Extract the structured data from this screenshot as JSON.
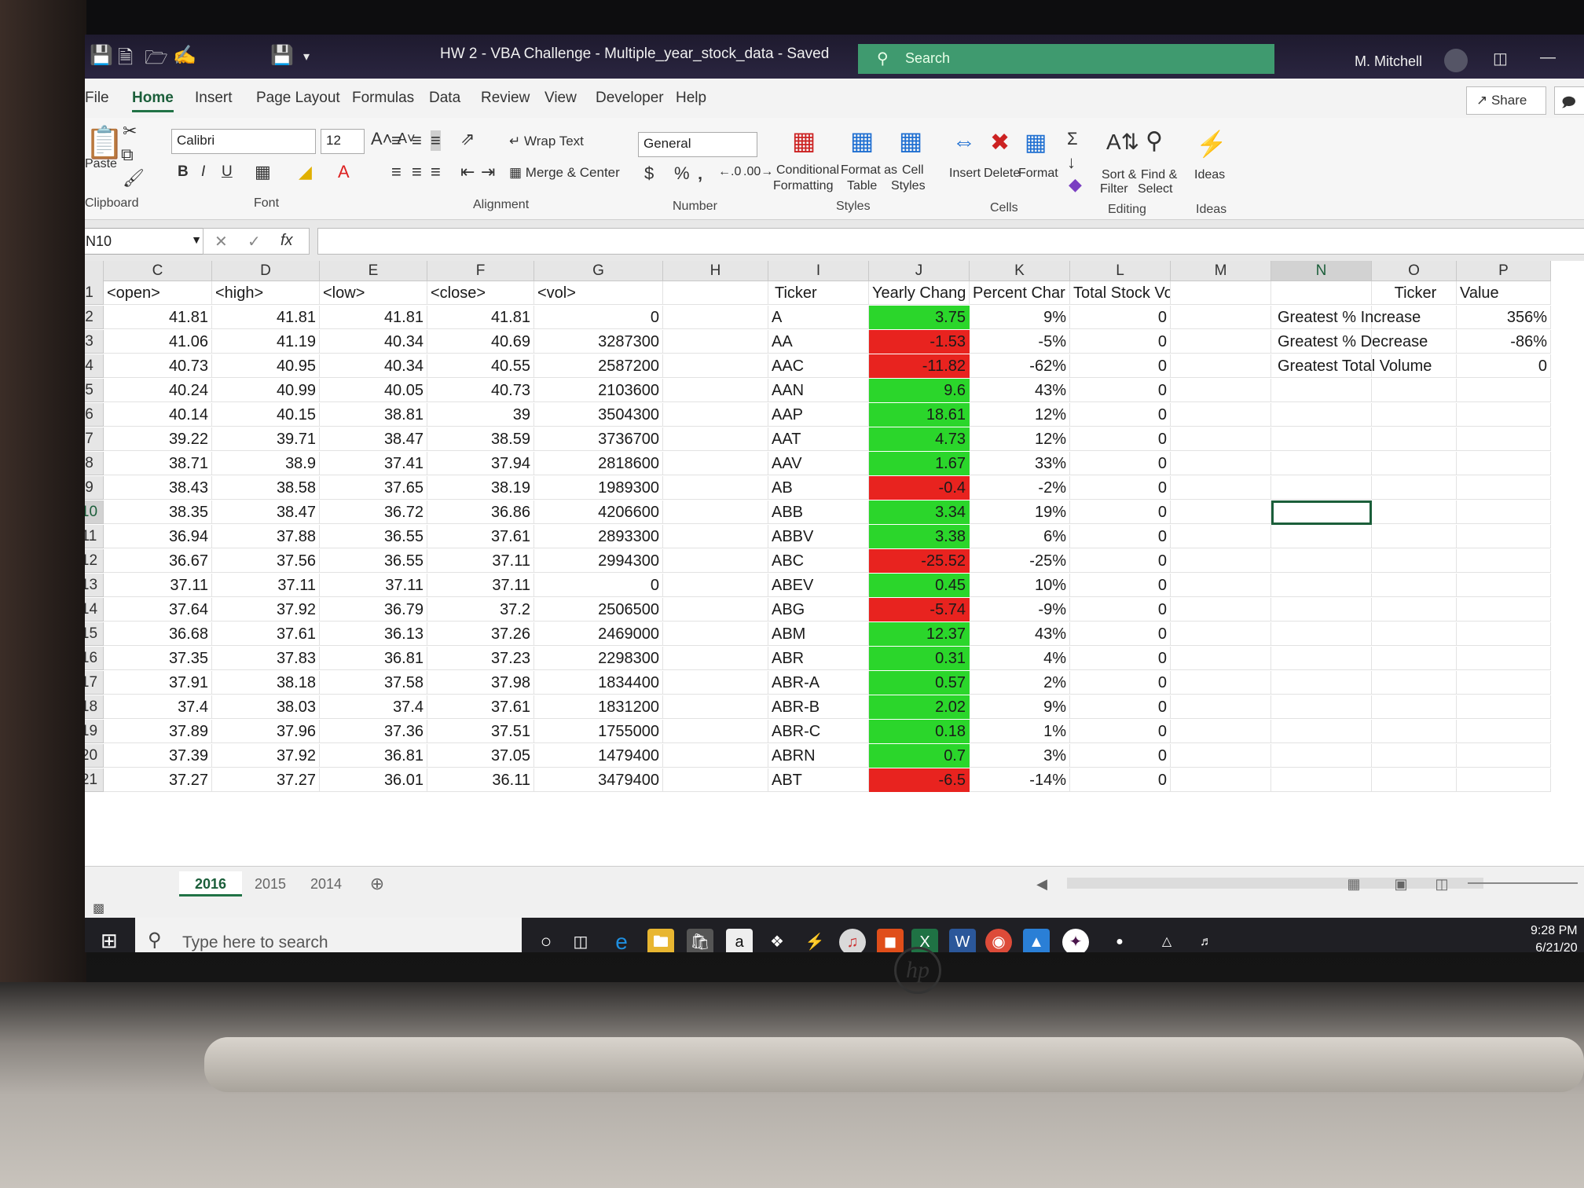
{
  "window": {
    "title": "HW 2 - VBA Challenge - Multiple_year_stock_data  -  Saved",
    "search_placeholder": "Search",
    "user": "M. Mitchell"
  },
  "tabs": [
    "File",
    "Home",
    "Insert",
    "Page Layout",
    "Formulas",
    "Data",
    "Review",
    "View",
    "Developer",
    "Help"
  ],
  "share_label": "Share",
  "ribbon": {
    "clipboard": {
      "paste": "Paste",
      "label": "Clipboard"
    },
    "font": {
      "family": "Calibri",
      "size": "12",
      "label": "Font"
    },
    "alignment": {
      "wrap": "Wrap Text",
      "merge": "Merge & Center",
      "label": "Alignment"
    },
    "number": {
      "format": "General",
      "label": "Number"
    },
    "styles": {
      "conditional_1": "Conditional",
      "conditional_2": "Formatting",
      "table_1": "Format as",
      "table_2": "Table",
      "cell_1": "Cell",
      "cell_2": "Styles",
      "label": "Styles"
    },
    "cells": {
      "insert": "Insert",
      "delete": "Delete",
      "format": "Format",
      "label": "Cells"
    },
    "editing": {
      "sort_1": "Sort &",
      "sort_2": "Filter",
      "find_1": "Find &",
      "find_2": "Select",
      "label": "Editing"
    },
    "ideas": {
      "btn": "Ideas",
      "label": "Ideas"
    }
  },
  "namebox": "N10",
  "fx": "fx",
  "columns": [
    "C",
    "D",
    "E",
    "F",
    "G",
    "H",
    "I",
    "J",
    "K",
    "L",
    "M",
    "N",
    "O",
    "P"
  ],
  "headers": [
    "<open>",
    "<high>",
    "<low>",
    "<close>",
    "<vol>",
    "",
    "Ticker",
    "Yearly Chang",
    "Percent Char",
    "Total Stock Volume",
    "",
    "",
    "Ticker",
    "Value"
  ],
  "rows": [
    {
      "n": "2",
      "open": "41.81",
      "high": "41.81",
      "low": "41.81",
      "close": "41.81",
      "vol": "0",
      "ticker": "A",
      "change": "3.75",
      "sign": "pos",
      "pct": "9%",
      "total": "0"
    },
    {
      "n": "3",
      "open": "41.06",
      "high": "41.19",
      "low": "40.34",
      "close": "40.69",
      "vol": "3287300",
      "ticker": "AA",
      "change": "-1.53",
      "sign": "neg",
      "pct": "-5%",
      "total": "0"
    },
    {
      "n": "4",
      "open": "40.73",
      "high": "40.95",
      "low": "40.34",
      "close": "40.55",
      "vol": "2587200",
      "ticker": "AAC",
      "change": "-11.82",
      "sign": "neg",
      "pct": "-62%",
      "total": "0"
    },
    {
      "n": "5",
      "open": "40.24",
      "high": "40.99",
      "low": "40.05",
      "close": "40.73",
      "vol": "2103600",
      "ticker": "AAN",
      "change": "9.6",
      "sign": "pos",
      "pct": "43%",
      "total": "0"
    },
    {
      "n": "6",
      "open": "40.14",
      "high": "40.15",
      "low": "38.81",
      "close": "39",
      "vol": "3504300",
      "ticker": "AAP",
      "change": "18.61",
      "sign": "pos",
      "pct": "12%",
      "total": "0"
    },
    {
      "n": "7",
      "open": "39.22",
      "high": "39.71",
      "low": "38.47",
      "close": "38.59",
      "vol": "3736700",
      "ticker": "AAT",
      "change": "4.73",
      "sign": "pos",
      "pct": "12%",
      "total": "0"
    },
    {
      "n": "8",
      "open": "38.71",
      "high": "38.9",
      "low": "37.41",
      "close": "37.94",
      "vol": "2818600",
      "ticker": "AAV",
      "change": "1.67",
      "sign": "pos",
      "pct": "33%",
      "total": "0"
    },
    {
      "n": "9",
      "open": "38.43",
      "high": "38.58",
      "low": "37.65",
      "close": "38.19",
      "vol": "1989300",
      "ticker": "AB",
      "change": "-0.4",
      "sign": "neg",
      "pct": "-2%",
      "total": "0"
    },
    {
      "n": "10",
      "open": "38.35",
      "high": "38.47",
      "low": "36.72",
      "close": "36.86",
      "vol": "4206600",
      "ticker": "ABB",
      "change": "3.34",
      "sign": "pos",
      "pct": "19%",
      "total": "0"
    },
    {
      "n": "11",
      "open": "36.94",
      "high": "37.88",
      "low": "36.55",
      "close": "37.61",
      "vol": "2893300",
      "ticker": "ABBV",
      "change": "3.38",
      "sign": "pos",
      "pct": "6%",
      "total": "0"
    },
    {
      "n": "12",
      "open": "36.67",
      "high": "37.56",
      "low": "36.55",
      "close": "37.11",
      "vol": "2994300",
      "ticker": "ABC",
      "change": "-25.52",
      "sign": "neg",
      "pct": "-25%",
      "total": "0"
    },
    {
      "n": "13",
      "open": "37.11",
      "high": "37.11",
      "low": "37.11",
      "close": "37.11",
      "vol": "0",
      "ticker": "ABEV",
      "change": "0.45",
      "sign": "pos",
      "pct": "10%",
      "total": "0"
    },
    {
      "n": "14",
      "open": "37.64",
      "high": "37.92",
      "low": "36.79",
      "close": "37.2",
      "vol": "2506500",
      "ticker": "ABG",
      "change": "-5.74",
      "sign": "neg",
      "pct": "-9%",
      "total": "0"
    },
    {
      "n": "15",
      "open": "36.68",
      "high": "37.61",
      "low": "36.13",
      "close": "37.26",
      "vol": "2469000",
      "ticker": "ABM",
      "change": "12.37",
      "sign": "pos",
      "pct": "43%",
      "total": "0"
    },
    {
      "n": "16",
      "open": "37.35",
      "high": "37.83",
      "low": "36.81",
      "close": "37.23",
      "vol": "2298300",
      "ticker": "ABR",
      "change": "0.31",
      "sign": "pos",
      "pct": "4%",
      "total": "0"
    },
    {
      "n": "17",
      "open": "37.91",
      "high": "38.18",
      "low": "37.58",
      "close": "37.98",
      "vol": "1834400",
      "ticker": "ABR-A",
      "change": "0.57",
      "sign": "pos",
      "pct": "2%",
      "total": "0"
    },
    {
      "n": "18",
      "open": "37.4",
      "high": "38.03",
      "low": "37.4",
      "close": "37.61",
      "vol": "1831200",
      "ticker": "ABR-B",
      "change": "2.02",
      "sign": "pos",
      "pct": "9%",
      "total": "0"
    },
    {
      "n": "19",
      "open": "37.89",
      "high": "37.96",
      "low": "37.36",
      "close": "37.51",
      "vol": "1755000",
      "ticker": "ABR-C",
      "change": "0.18",
      "sign": "pos",
      "pct": "1%",
      "total": "0"
    },
    {
      "n": "20",
      "open": "37.39",
      "high": "37.92",
      "low": "36.81",
      "close": "37.05",
      "vol": "1479400",
      "ticker": "ABRN",
      "change": "0.7",
      "sign": "pos",
      "pct": "3%",
      "total": "0"
    },
    {
      "n": "21",
      "open": "37.27",
      "high": "37.27",
      "low": "36.01",
      "close": "36.11",
      "vol": "3479400",
      "ticker": "ABT",
      "change": "-6.5",
      "sign": "neg",
      "pct": "-14%",
      "total": "0"
    }
  ],
  "summary": [
    {
      "label": "Greatest % Increase",
      "value": "356%"
    },
    {
      "label": "Greatest % Decrease",
      "value": "-86%"
    },
    {
      "label": "Greatest Total Volume",
      "value": "0"
    }
  ],
  "sheets": [
    "2016",
    "2015",
    "2014"
  ],
  "taskbar": {
    "search_placeholder": "Type here to search",
    "time": "9:28 PM",
    "date": "6/21/20"
  },
  "colors": {
    "positive": "#2bd62b",
    "negative": "#e8231f",
    "accent": "#217346"
  }
}
